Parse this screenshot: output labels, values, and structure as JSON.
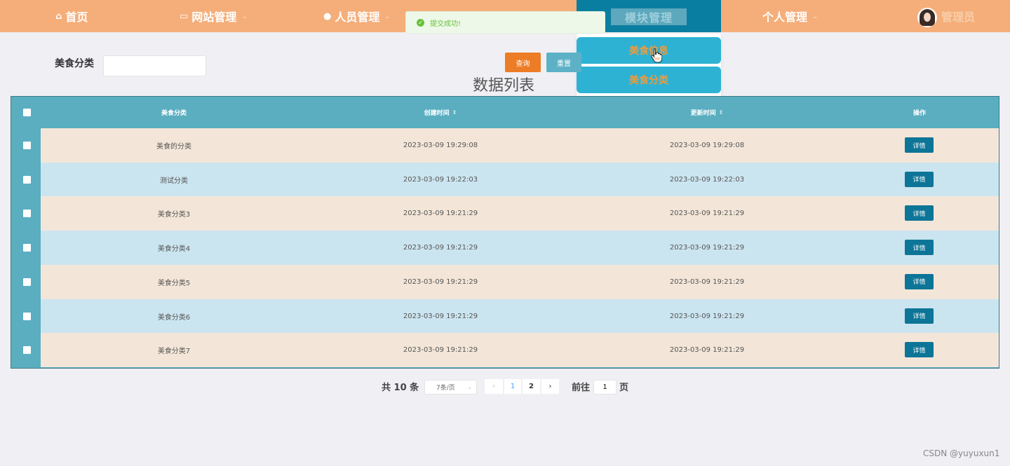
{
  "nav": {
    "home": "首页",
    "site_mgmt": "网站管理",
    "people_mgmt": "人员管理",
    "module_mgmt": "模块管理",
    "personal_mgmt": "个人管理",
    "user_name": "管理员",
    "home_icon": "home-icon",
    "site_icon": "monitor-icon",
    "people_icon": "user-icon"
  },
  "toast": {
    "message": "提交成功!",
    "icon": "success-check-icon"
  },
  "dropdown": {
    "items": [
      "美食信息",
      "美食分类"
    ]
  },
  "search": {
    "label": "美食分类",
    "value": "",
    "placeholder": "",
    "query_label": "查询",
    "reset_label": "重置"
  },
  "list_title": "数据列表",
  "table": {
    "columns": [
      "美食分类",
      "创建时间",
      "更新时间",
      "操作"
    ],
    "detail_label": "详情",
    "rows": [
      {
        "category": "美食的分类",
        "created": "2023-03-09 19:29:08",
        "updated": "2023-03-09 19:29:08"
      },
      {
        "category": "测试分类",
        "created": "2023-03-09 19:22:03",
        "updated": "2023-03-09 19:22:03"
      },
      {
        "category": "美食分类3",
        "created": "2023-03-09 19:21:29",
        "updated": "2023-03-09 19:21:29"
      },
      {
        "category": "美食分类4",
        "created": "2023-03-09 19:21:29",
        "updated": "2023-03-09 19:21:29"
      },
      {
        "category": "美食分类5",
        "created": "2023-03-09 19:21:29",
        "updated": "2023-03-09 19:21:29"
      },
      {
        "category": "美食分类6",
        "created": "2023-03-09 19:21:29",
        "updated": "2023-03-09 19:21:29"
      },
      {
        "category": "美食分类7",
        "created": "2023-03-09 19:21:29",
        "updated": "2023-03-09 19:21:29"
      }
    ]
  },
  "pagination": {
    "total": "共 10 条",
    "page_size": "7条/页",
    "pages": [
      "1",
      "2"
    ],
    "current_page": "1",
    "goto_label": "前往",
    "goto_value": "1",
    "page_suffix": "页"
  },
  "colors": {
    "nav_bg": "#f5ae7a",
    "nav_active": "#0a7ea0",
    "table_header": "#5aaec0",
    "row_tan": "#f3e6d8",
    "row_blue": "#cbe5f0",
    "query_btn": "#ec7d26",
    "reset_btn": "#5db1c6",
    "detail_btn": "#0d7597",
    "dropdown_item": "#2db2d3"
  },
  "watermark": "CSDN @yuyuxun1"
}
